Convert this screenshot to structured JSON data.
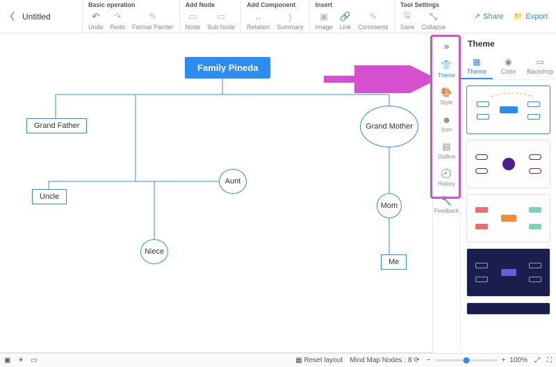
{
  "title": "Untitled",
  "toolbar": {
    "groups": [
      {
        "label": "Basic operation",
        "items": [
          {
            "n": "undo",
            "l": "Undo",
            "g": "↶",
            "on": true
          },
          {
            "n": "redo",
            "l": "Redo",
            "g": "↷"
          },
          {
            "n": "format",
            "l": "Format Painter",
            "g": "✎"
          }
        ]
      },
      {
        "label": "Add Node",
        "items": [
          {
            "n": "node",
            "l": "Node",
            "g": "▭"
          },
          {
            "n": "subnode",
            "l": "Sub Node",
            "g": "▭"
          }
        ]
      },
      {
        "label": "Add Component",
        "items": [
          {
            "n": "relation",
            "l": "Relation",
            "g": "↔"
          },
          {
            "n": "summary",
            "l": "Summary",
            "g": "}"
          }
        ]
      },
      {
        "label": "Insert",
        "items": [
          {
            "n": "image",
            "l": "Image",
            "g": "▣"
          },
          {
            "n": "link",
            "l": "Link",
            "g": "🔗"
          },
          {
            "n": "comments",
            "l": "Comments",
            "g": "✎"
          }
        ]
      },
      {
        "label": "Tool Settings",
        "items": [
          {
            "n": "save",
            "l": "Save",
            "g": "🖫"
          },
          {
            "n": "collapse",
            "l": "Collapse",
            "g": "⤡",
            "on": true
          }
        ]
      }
    ],
    "share": "Share",
    "export": "Export"
  },
  "nodes": {
    "root": "Family Pineda",
    "grandfather": "Grand Father",
    "grandmother": "Grand Mother",
    "uncle": "Uncle",
    "aunt": "Aunt",
    "mom": "Mom",
    "niece": "Niece",
    "me": "Me"
  },
  "side": {
    "items": [
      {
        "n": "theme",
        "l": "Theme",
        "g": "👕",
        "on": true
      },
      {
        "n": "style",
        "l": "Style",
        "g": "🎨"
      },
      {
        "n": "icon",
        "l": "Icon",
        "g": "☻"
      },
      {
        "n": "outline",
        "l": "Outline",
        "g": "▤"
      },
      {
        "n": "history",
        "l": "History",
        "g": "🕘"
      },
      {
        "n": "feedback",
        "l": "Feedback",
        "g": "🔧"
      }
    ],
    "panel_title": "Theme",
    "tabs": [
      {
        "n": "theme",
        "l": "Theme",
        "g": "▦",
        "on": true
      },
      {
        "n": "color",
        "l": "Color",
        "g": "◉"
      },
      {
        "n": "backdrop",
        "l": "Backdrop",
        "g": "▭"
      }
    ]
  },
  "status": {
    "reset": "Reset layout",
    "nodes_label": "Mind Map Nodes :",
    "nodes_count": "8",
    "zoom": "100%"
  }
}
